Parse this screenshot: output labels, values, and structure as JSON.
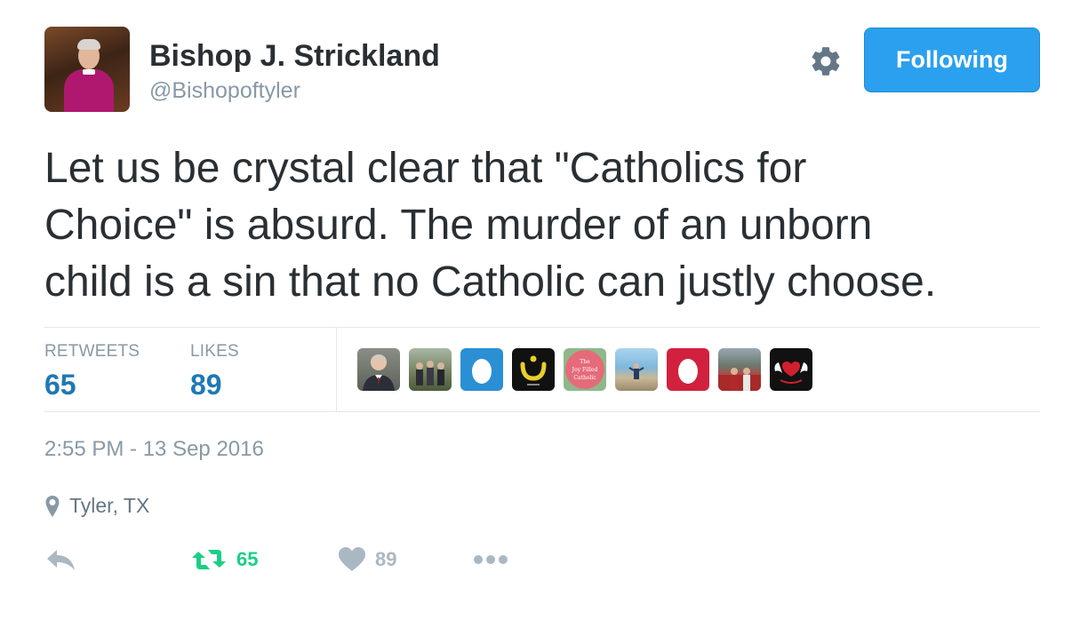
{
  "user": {
    "name": "Bishop J. Strickland",
    "handle": "@Bishopoftyler"
  },
  "header": {
    "follow_label": "Following"
  },
  "tweet": {
    "lines": [
      "Let us be crystal clear that \"Catholics for",
      "Choice\" is absurd.  The murder of an unborn",
      "child is a sin that no Catholic can justly choose."
    ]
  },
  "stats": {
    "retweets_label": "RETWEETS",
    "retweets_count": "65",
    "likes_label": "LIKES",
    "likes_count": "89",
    "liker_avatars": [
      {
        "icon": "man-in-suit-avatar"
      },
      {
        "icon": "group-photo-avatar"
      },
      {
        "icon": "default-egg-avatar-blue",
        "color": "#2b8fd4"
      },
      {
        "icon": "nun-arabic-letter-avatar",
        "glyph": "ن"
      },
      {
        "icon": "pink-circle-logo-avatar",
        "logo_text": "The Joy Filled Catholic"
      },
      {
        "icon": "beach-photo-avatar"
      },
      {
        "icon": "default-egg-avatar-red",
        "color": "#d1213f"
      },
      {
        "icon": "stadium-photo-avatar"
      },
      {
        "icon": "red-heart-wings-avatar"
      }
    ]
  },
  "meta": {
    "timestamp": "2:55 PM - 13 Sep 2016",
    "location": "Tyler, TX"
  },
  "actions": {
    "retweet_count": "65",
    "like_count": "89"
  },
  "colors": {
    "accent": "#2ba0ee",
    "count_blue": "#1f78b4",
    "retweet_green": "#19cf86",
    "muted": "#8899a6",
    "action_gray": "#aab8c2"
  }
}
